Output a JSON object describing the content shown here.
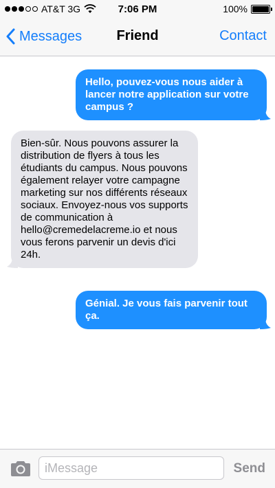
{
  "status_bar": {
    "carrier": "AT&T 3G",
    "time": "7:06 PM",
    "battery": "100%",
    "signal_bars": 5,
    "signal_filled": 3
  },
  "nav": {
    "back_label": "Messages",
    "title": "Friend",
    "contact_label": "Contact"
  },
  "messages": [
    {
      "direction": "sent",
      "text": "Hello, pouvez-vous nous aider à lancer notre application sur votre campus ?"
    },
    {
      "direction": "received",
      "text": "Bien-sûr. Nous pouvons assurer la distribution de flyers à tous les étudiants du campus. Nous pouvons également relayer votre campagne marketing sur nos différents réseaux sociaux. Envoyez-nous vos supports de communication à hello@cremedelacreme.io et nous vous ferons parvenir un devis d'ici 24h."
    },
    {
      "direction": "sent",
      "text": "Génial. Je vous fais parvenir tout ça."
    }
  ],
  "input_bar": {
    "placeholder": "iMessage",
    "send_label": "Send",
    "camera_icon": "camera-icon"
  },
  "colors": {
    "accent": "#147efb",
    "sent_bubble": "#1e90ff",
    "received_bubble": "#e5e5ea"
  }
}
